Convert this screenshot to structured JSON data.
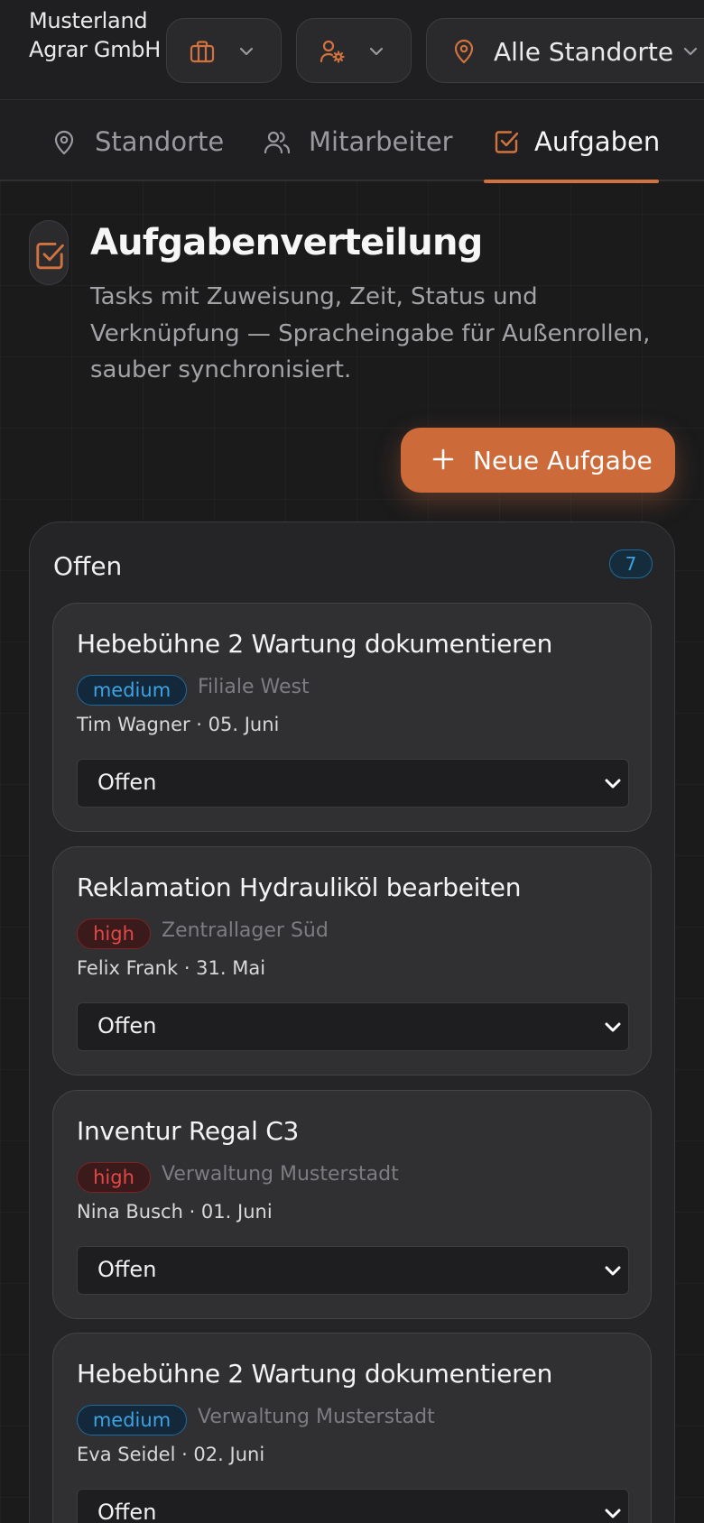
{
  "header": {
    "company": "Musterland Agrar GmbH",
    "location_selector": {
      "label": "Alle Standorte"
    }
  },
  "tabs": [
    {
      "label": "Standorte",
      "icon": "map-pin-icon",
      "active": false
    },
    {
      "label": "Mitarbeiter",
      "icon": "users-icon",
      "active": false
    },
    {
      "label": "Aufgaben",
      "icon": "checkbox-icon",
      "active": true
    }
  ],
  "page": {
    "title": "Aufgabenverteilung",
    "subtitle": "Tasks mit Zuweisung, Zeit, Status und Verknüpfung — Spracheingabe für Außenrollen, sauber synchronisiert.",
    "new_task_label": "Neue Aufgabe"
  },
  "column": {
    "title": "Offen",
    "count": "7",
    "cards": [
      {
        "title": "Hebebühne 2 Wartung dokumentieren",
        "priority": "medium",
        "location": "Filiale West",
        "meta": "Tim Wagner · 05. Juni",
        "status": "Offen"
      },
      {
        "title": "Reklamation Hydrauliköl bearbeiten",
        "priority": "high",
        "location": "Zentrallager Süd",
        "meta": "Felix Frank · 31. Mai",
        "status": "Offen"
      },
      {
        "title": "Inventur Regal C3",
        "priority": "high",
        "location": "Verwaltung Musterstadt",
        "meta": "Nina Busch · 01. Juni",
        "status": "Offen"
      },
      {
        "title": "Hebebühne 2 Wartung dokumentieren",
        "priority": "medium",
        "location": "Verwaltung Musterstadt",
        "meta": "Eva Seidel · 02. Juni",
        "status": "Offen"
      }
    ]
  },
  "colors": {
    "accent": "#cd6a3a",
    "background": "#1b1b1c",
    "priority_medium": "#3ea3e0",
    "priority_high": "#e24848"
  }
}
